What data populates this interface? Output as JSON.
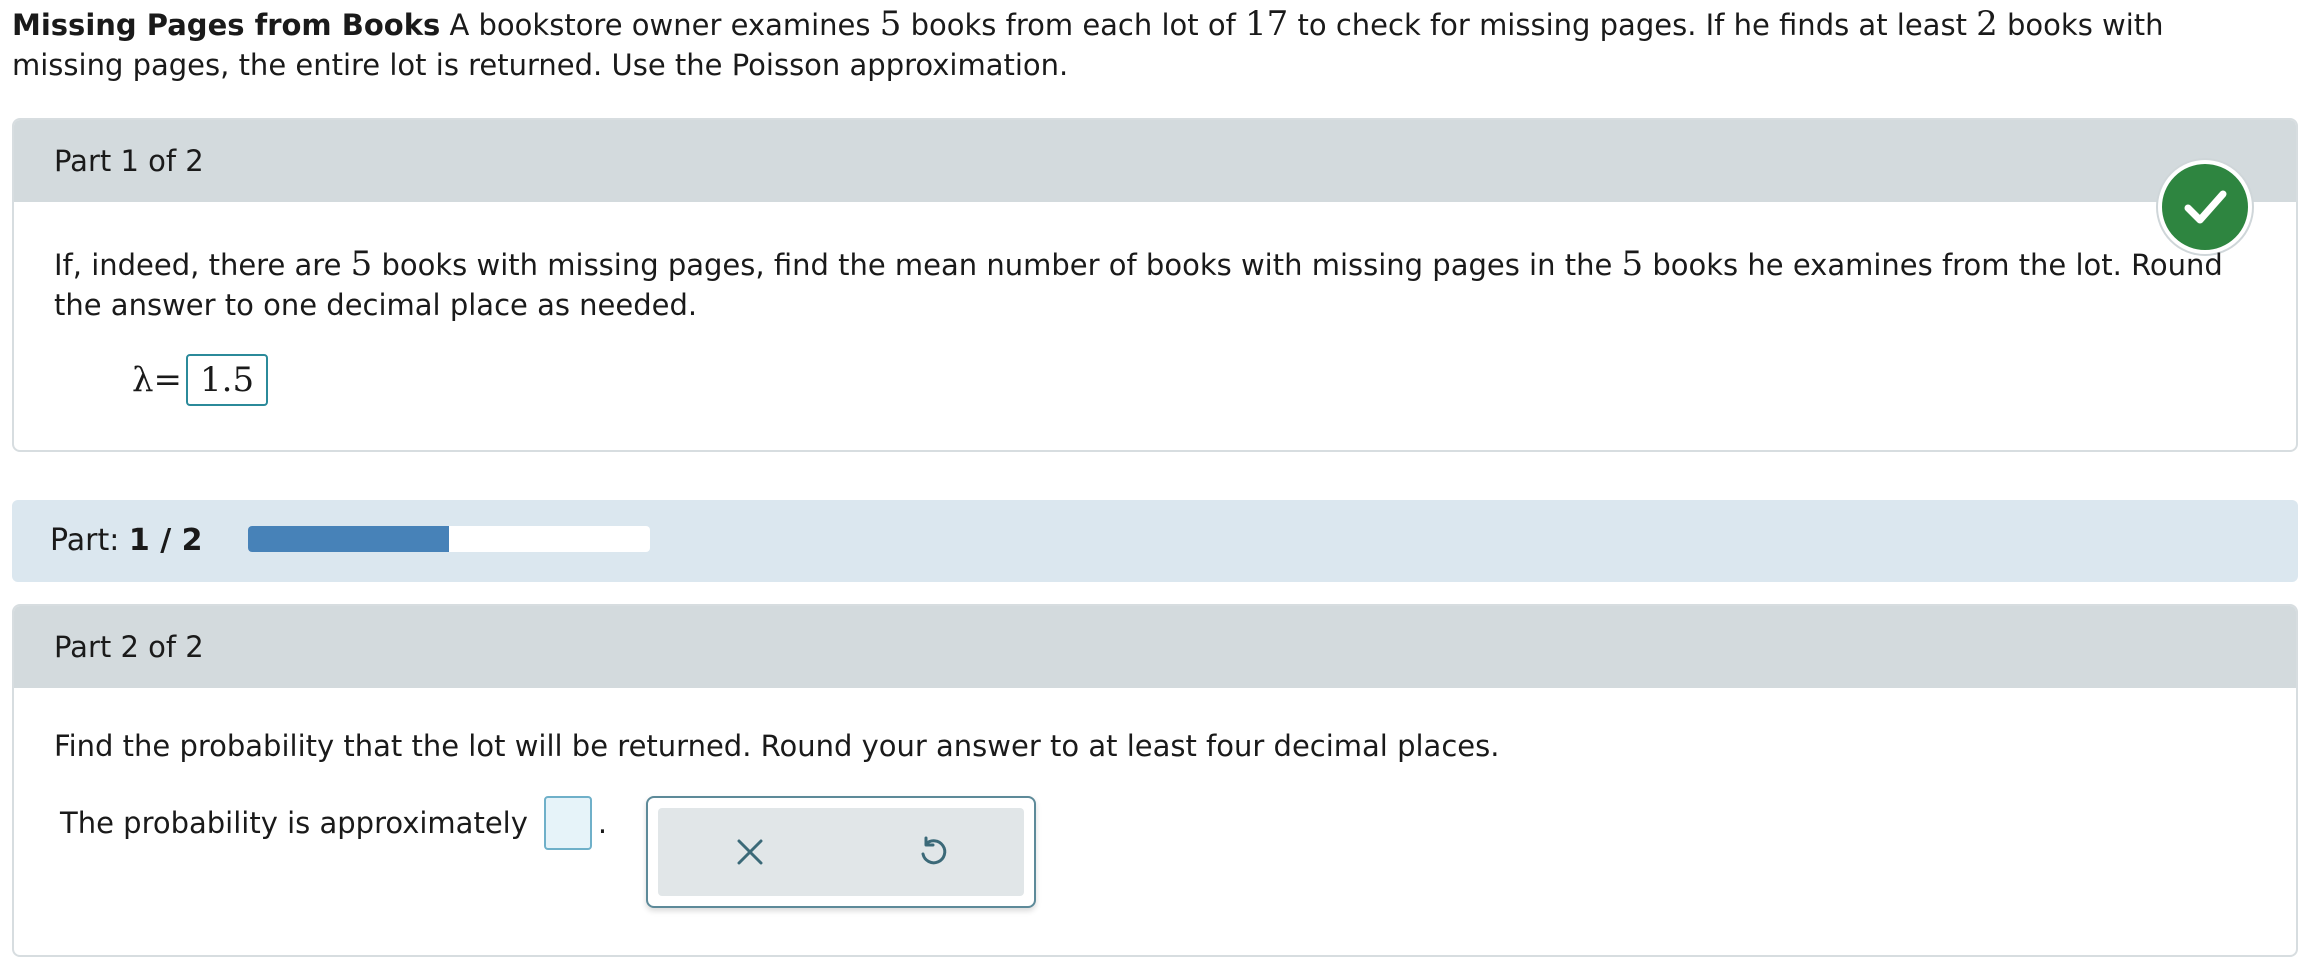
{
  "problem": {
    "title": "Missing Pages from Books",
    "text_a": " A bookstore owner examines ",
    "n_sample": "5",
    "text_b": " books from each lot of ",
    "lot_size": "17",
    "text_c": " to check for missing pages. If he finds at least ",
    "threshold": "2",
    "text_d": " books with missing pages, the entire lot is returned. Use the Poisson approximation."
  },
  "part1": {
    "header": "Part 1 of 2",
    "q_a": "If, indeed, there are ",
    "q_n1": "5",
    "q_b": " books with missing pages, find the mean number of books with missing pages in the ",
    "q_n2": "5",
    "q_c": " books he examines from the lot. Round the answer to one decimal place as needed.",
    "lambda_label": "λ=",
    "lambda_value": "1.5",
    "status_icon": "checkmark-icon",
    "status_color": "#2e8540"
  },
  "progress": {
    "label": "Part: ",
    "current": "1 / 2",
    "fraction": 0.5,
    "fill_color": "#4782b8"
  },
  "part2": {
    "header": "Part 2 of 2",
    "question": "Find the probability that the lot will be returned. Round your answer to at least four decimal places.",
    "answer_prefix": "The probability is approximately",
    "answer_value": "",
    "answer_suffix": ".",
    "tools": [
      {
        "icon": "close-icon"
      },
      {
        "icon": "undo-icon"
      }
    ]
  }
}
